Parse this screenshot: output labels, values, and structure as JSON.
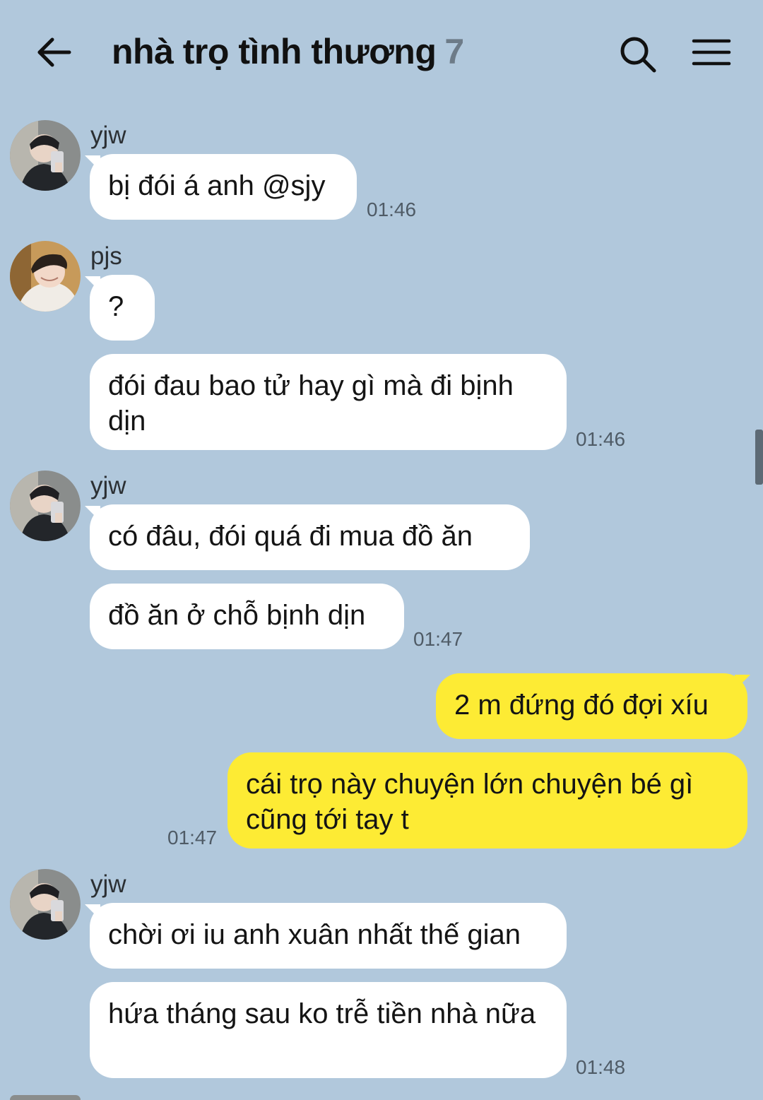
{
  "header": {
    "title": "nhà trọ tình thương",
    "member_count": "7",
    "back_icon": "back-arrow-icon",
    "search_icon": "search-icon",
    "menu_icon": "menu-icon"
  },
  "messages": [
    {
      "sender": "yjw",
      "text": "bị đói á anh @sjy",
      "time": "01:46"
    },
    {
      "sender": "pjs",
      "text": "?"
    },
    {
      "sender": "pjs",
      "text": "đói đau bao tử hay gì mà đi bịnh dịn",
      "time": "01:46"
    },
    {
      "sender": "yjw",
      "text": "có đâu, đói quá đi mua đồ ăn"
    },
    {
      "sender": "yjw",
      "text": "đồ ăn ở chỗ bịnh dịn",
      "time": "01:47"
    },
    {
      "sender": "me",
      "text": "2 m đứng đó đợi xíu"
    },
    {
      "sender": "me",
      "text": "cái trọ này chuyện lớn chuyện bé gì cũng tới tay t",
      "time": "01:47"
    },
    {
      "sender": "yjw",
      "text": "chời ơi iu anh xuân nhất thế gian"
    },
    {
      "sender": "yjw",
      "text": "hứa tháng sau ko trễ tiền nhà nữa",
      "time": "01:48"
    }
  ],
  "colors": {
    "background": "#b1c8dc",
    "incoming_bubble": "#ffffff",
    "outgoing_bubble": "#fdeb34",
    "count_color": "#6d7b88"
  }
}
